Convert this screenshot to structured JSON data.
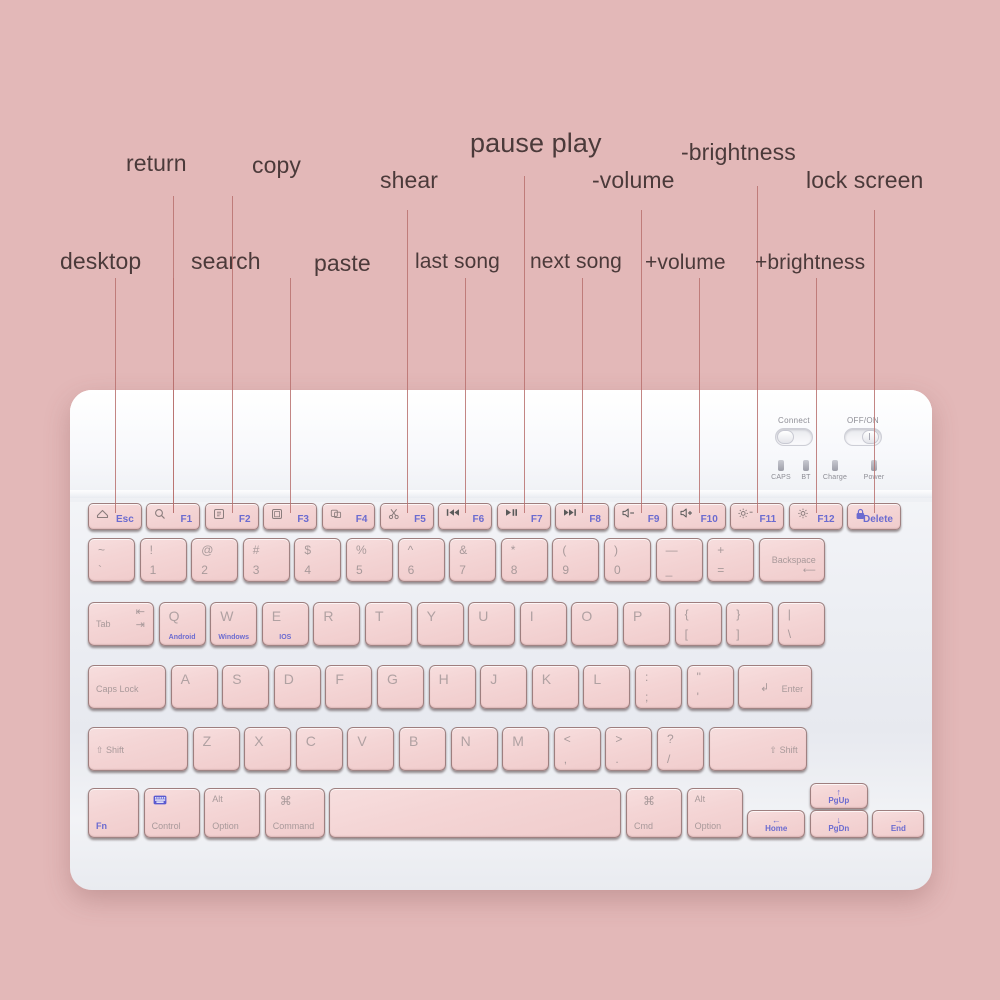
{
  "scene": {
    "title": "Wireless keyboard annotated function-key diagram",
    "background_color": "#e3b8b8",
    "keyboard_color": "#eef0f4",
    "key_color": "#f3d3d3",
    "leader_line_color": "#b9716f",
    "annotation_text_color": "#4b3a3a",
    "fn_blue": "#6b6bd0"
  },
  "annotations": [
    {
      "label": "desktop",
      "key": "Esc",
      "row": "lower"
    },
    {
      "label": "return",
      "key": "F1",
      "row": "upper"
    },
    {
      "label": "search",
      "key": "F1",
      "row": "lower"
    },
    {
      "label": "copy",
      "key": "F2",
      "row": "upper"
    },
    {
      "label": "paste",
      "key": "F3",
      "row": "lower"
    },
    {
      "label": "shear",
      "key": "F5",
      "row": "upper"
    },
    {
      "label": "last song",
      "key": "F6",
      "row": "lower"
    },
    {
      "label": "pause play",
      "key": "F7",
      "row": "upper"
    },
    {
      "label": "next song",
      "key": "F8",
      "row": "lower"
    },
    {
      "label": "-volume",
      "key": "F9",
      "row": "upper"
    },
    {
      "label": "+volume",
      "key": "F10",
      "row": "lower"
    },
    {
      "label": "-brightness",
      "key": "F11",
      "row": "upper"
    },
    {
      "label": "+brightness",
      "key": "F12",
      "row": "lower"
    },
    {
      "label": "lock screen",
      "key": "Delete",
      "row": "upper"
    }
  ],
  "keyboard": {
    "indicator_panel": {
      "connect_label": "Connect",
      "power_label": "OFF/ON",
      "leds": [
        "CAPS",
        "BT",
        "Charge",
        "Power"
      ]
    },
    "function_row": [
      {
        "fn": "Esc",
        "icon": "home-icon",
        "fn_label": "Esc"
      },
      {
        "fn": "F1",
        "icon": "search-icon",
        "fn_label": "F1"
      },
      {
        "fn": "F2",
        "icon": "copy-icon",
        "fn_label": "F2"
      },
      {
        "fn": "F3",
        "icon": "paste-icon",
        "fn_label": "F3"
      },
      {
        "fn": "F4",
        "icon": "shear-icon",
        "fn_label": "F4"
      },
      {
        "fn": "F5",
        "icon": "scissors-icon",
        "fn_label": "F5"
      },
      {
        "fn": "F6",
        "icon": "prev-track-icon",
        "fn_label": "F6"
      },
      {
        "fn": "F7",
        "icon": "play-pause-icon",
        "fn_label": "F7"
      },
      {
        "fn": "F8",
        "icon": "next-track-icon",
        "fn_label": "F8"
      },
      {
        "fn": "F9",
        "icon": "volume-down-icon",
        "fn_label": "F9"
      },
      {
        "fn": "F10",
        "icon": "volume-up-icon",
        "fn_label": "F10"
      },
      {
        "fn": "F11",
        "icon": "brightness-down-icon",
        "fn_label": "F11"
      },
      {
        "fn": "F12",
        "icon": "brightness-up-icon",
        "fn_label": "F12"
      },
      {
        "fn": "Delete",
        "icon": "lock-icon",
        "fn_label": "Delete"
      }
    ],
    "number_row": [
      {
        "top": "~",
        "bottom": "`"
      },
      {
        "top": "!",
        "bottom": "1"
      },
      {
        "top": "@",
        "bottom": "2"
      },
      {
        "top": "#",
        "bottom": "3"
      },
      {
        "top": "$",
        "bottom": "4"
      },
      {
        "top": "%",
        "bottom": "5"
      },
      {
        "top": "^",
        "bottom": "6"
      },
      {
        "top": "&",
        "bottom": "7"
      },
      {
        "top": "*",
        "bottom": "8"
      },
      {
        "top": "(",
        "bottom": "9"
      },
      {
        "top": ")",
        "bottom": "0"
      },
      {
        "top": "—",
        "bottom": "_"
      },
      {
        "top": "+",
        "bottom": "="
      },
      {
        "top": "",
        "bottom": "",
        "name": "Backspace"
      }
    ],
    "qwerty_row": [
      {
        "name": "Tab"
      },
      {
        "letter": "Q",
        "os": "Android"
      },
      {
        "letter": "W",
        "os": "Windows"
      },
      {
        "letter": "E",
        "os": "IOS"
      },
      {
        "letter": "R"
      },
      {
        "letter": "T"
      },
      {
        "letter": "Y"
      },
      {
        "letter": "U"
      },
      {
        "letter": "I"
      },
      {
        "letter": "O"
      },
      {
        "letter": "P"
      },
      {
        "top": "{",
        "bottom": "["
      },
      {
        "top": "}",
        "bottom": "]"
      },
      {
        "top": "|",
        "bottom": "\\"
      }
    ],
    "home_row": [
      {
        "name": "Caps Lock"
      },
      {
        "letter": "A"
      },
      {
        "letter": "S"
      },
      {
        "letter": "D"
      },
      {
        "letter": "F"
      },
      {
        "letter": "G"
      },
      {
        "letter": "H"
      },
      {
        "letter": "J"
      },
      {
        "letter": "K"
      },
      {
        "letter": "L"
      },
      {
        "top": ":",
        "bottom": ";"
      },
      {
        "top": "\"",
        "bottom": "'"
      },
      {
        "name": "Enter"
      }
    ],
    "shift_row": [
      {
        "name": "Shift"
      },
      {
        "letter": "Z"
      },
      {
        "letter": "X"
      },
      {
        "letter": "C"
      },
      {
        "letter": "V"
      },
      {
        "letter": "B"
      },
      {
        "letter": "N"
      },
      {
        "letter": "M"
      },
      {
        "top": "<",
        "bottom": ","
      },
      {
        "top": ">",
        "bottom": "."
      },
      {
        "top": "?",
        "bottom": "/"
      },
      {
        "name": "Shift"
      }
    ],
    "bottom_row": [
      {
        "name": "Fn"
      },
      {
        "name": "Control",
        "icon": "keyboard-icon"
      },
      {
        "name": "Option",
        "alt": "Alt"
      },
      {
        "name": "Command",
        "alt": "⌘"
      },
      {
        "name": "Space"
      },
      {
        "name": "Cmd",
        "alt": "⌘"
      },
      {
        "name": "Option",
        "alt": "Alt"
      },
      {
        "name": "Home",
        "arrow": "←"
      },
      {
        "name": "PgUp",
        "arrow": "↑"
      },
      {
        "name": "PgDn",
        "arrow": "↓"
      },
      {
        "name": "End",
        "arrow": "→"
      }
    ]
  }
}
